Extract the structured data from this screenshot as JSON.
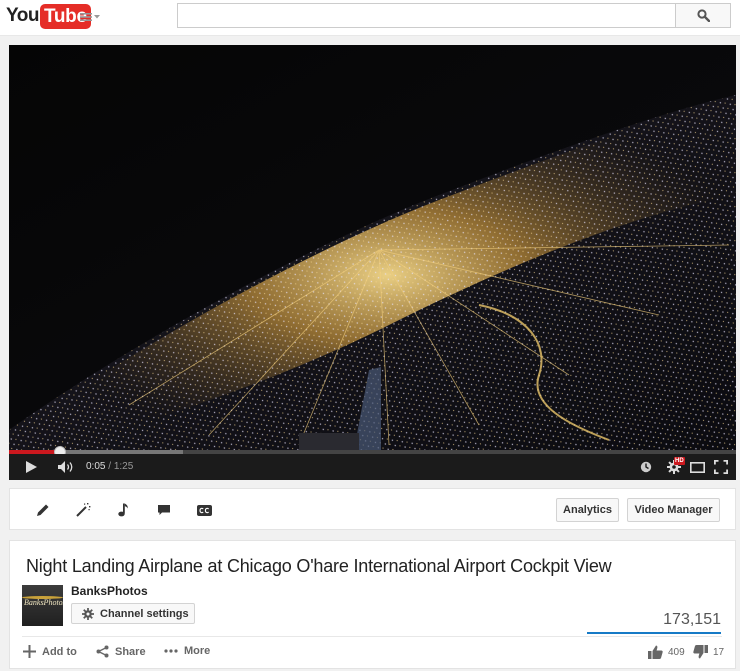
{
  "masthead": {
    "logo_you": "You",
    "logo_tube": "Tube",
    "search_placeholder": "",
    "search_value": ""
  },
  "player": {
    "current_time": "0:05",
    "separator": "/",
    "duration": "1:25",
    "played_fraction": 0.07,
    "buffered_fraction": 0.24,
    "hd_badge": "HD",
    "icons": [
      "play-icon",
      "volume-icon",
      "watch-later-icon",
      "settings-icon",
      "theater-icon",
      "fullscreen-icon"
    ]
  },
  "creator_bar": {
    "tools": [
      "pencil-icon",
      "magic-wand-icon",
      "music-note-icon",
      "comment-icon",
      "cc-icon"
    ],
    "analytics_label": "Analytics",
    "video_manager_label": "Video Manager"
  },
  "video_info": {
    "title": "Night Landing Airplane at Chicago O'hare International Airport Cockpit View",
    "channel_name": "BanksPhotos",
    "avatar_text": "BanksPhotos",
    "channel_settings_label": "Channel settings",
    "view_count": "173,151",
    "actions": {
      "add_to": "Add to",
      "share": "Share",
      "more": "More"
    },
    "likes": "409",
    "dislikes": "17"
  },
  "colors": {
    "brand_red": "#e52d27",
    "progress_red": "#cc181e",
    "view_bar_blue": "#167ac6"
  }
}
